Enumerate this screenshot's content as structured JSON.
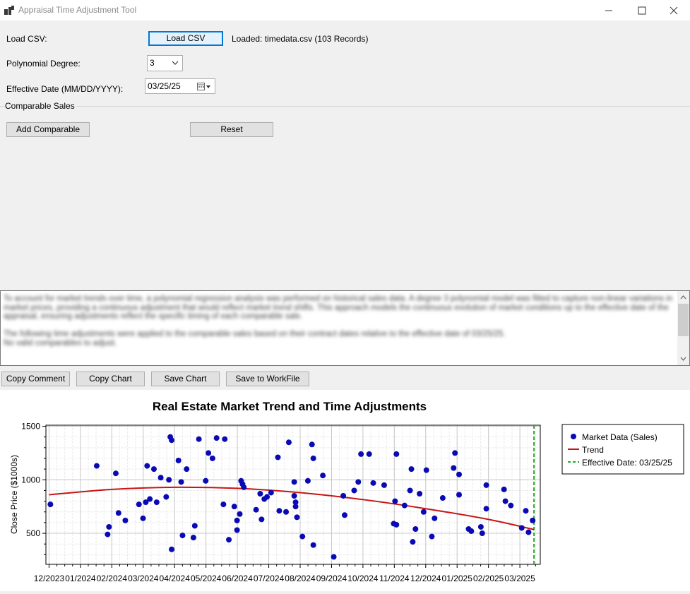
{
  "window": {
    "title": "Appraisal Time Adjustment Tool"
  },
  "form": {
    "load_csv_label": "Load CSV:",
    "load_csv_button": "Load CSV",
    "load_status": "Loaded: timedata.csv (103 Records)",
    "poly_degree_label": "Polynomial Degree:",
    "poly_degree_value": "3",
    "effective_date_label": "Effective Date (MM/DD/YYYY):",
    "effective_date_value": "03/25/25"
  },
  "comparables": {
    "group_title": "Comparable Sales",
    "add_button": "Add Comparable",
    "reset_button": "Reset"
  },
  "comment": {
    "paragraph1": "To account for market trends over time, a polynomial regression analysis was performed on historical sales data. A degree 3 polynomial model was fitted to capture non-linear variations in market prices, providing a continuous adjustment that would reflect market trend shifts. This approach models the continuous evolution of market conditions up to the effective date of the appraisal, ensuring adjustments reflect the specific timing of each comparable sale.",
    "paragraph2": "The following time adjustments were applied to the comparable sales based on their contract dates relative to the effective date of 03/25/25.",
    "paragraph3": "No valid comparables to adjust."
  },
  "actions": {
    "copy_comment": "Copy Comment",
    "copy_chart": "Copy Chart",
    "save_chart": "Save Chart",
    "save_workfile": "Save to WorkFile"
  },
  "colors": {
    "point": "#0a0ab4",
    "trend": "#c81414",
    "effective": "#22aa22",
    "accent": "#0078d7"
  },
  "chart_data": {
    "type": "scatter",
    "title": "Real Estate Market Trend and Time Adjustments",
    "xlabel": "",
    "ylabel": "Close Price ($1000s)",
    "x_tick_labels": [
      "12/2023",
      "01/2024",
      "02/2024",
      "03/2024",
      "04/2024",
      "05/2024",
      "06/2024",
      "07/2024",
      "08/2024",
      "09/2024",
      "10/2024",
      "11/2024",
      "12/2024",
      "01/2025",
      "02/2025",
      "03/2025"
    ],
    "y_ticks": [
      500,
      1000,
      1500
    ],
    "ylim": [
      210,
      1510
    ],
    "xlim_months": [
      -0.1,
      15.65
    ],
    "grid": true,
    "legend_position": "right",
    "legend": [
      "Market Data (Sales)",
      "Trend",
      "Effective Date: 03/25/25"
    ],
    "effective_date_month": 15.45,
    "trend": {
      "months": [
        0,
        2,
        4,
        6,
        8,
        10,
        12,
        14,
        15.45
      ],
      "values": [
        860,
        910,
        930,
        920,
        880,
        815,
        730,
        630,
        535
      ]
    },
    "points": [
      [
        0.05,
        770
      ],
      [
        1.75,
        1130
      ],
      [
        2.15,
        490
      ],
      [
        2.2,
        560
      ],
      [
        2.45,
        1060
      ],
      [
        2.55,
        690
      ],
      [
        2.8,
        620
      ],
      [
        3.3,
        770
      ],
      [
        3.45,
        640
      ],
      [
        3.6,
        1130
      ],
      [
        3.7,
        820
      ],
      [
        3.85,
        1100
      ],
      [
        3.95,
        790
      ],
      [
        4.1,
        1020
      ],
      [
        4.3,
        840
      ],
      [
        4.4,
        1000
      ],
      [
        4.45,
        1400
      ],
      [
        4.5,
        1370
      ],
      [
        4.5,
        350
      ],
      [
        4.75,
        1180
      ],
      [
        4.85,
        980
      ],
      [
        4.9,
        480
      ],
      [
        5.05,
        1100
      ],
      [
        5.3,
        460
      ],
      [
        5.35,
        570
      ],
      [
        5.5,
        1380
      ],
      [
        5.75,
        990
      ],
      [
        5.85,
        1250
      ],
      [
        6.0,
        1200
      ],
      [
        6.15,
        1390
      ],
      [
        6.4,
        770
      ],
      [
        6.6,
        440
      ],
      [
        6.8,
        750
      ],
      [
        6.9,
        620
      ],
      [
        6.9,
        530
      ],
      [
        7.0,
        680
      ],
      [
        7.05,
        990
      ],
      [
        7.1,
        960
      ],
      [
        7.15,
        930
      ],
      [
        7.6,
        720
      ],
      [
        7.75,
        870
      ],
      [
        7.8,
        630
      ],
      [
        7.9,
        820
      ],
      [
        8.0,
        840
      ],
      [
        8.15,
        880
      ],
      [
        8.4,
        1210
      ],
      [
        8.45,
        710
      ],
      [
        8.7,
        700
      ],
      [
        8.8,
        1350
      ],
      [
        9.0,
        980
      ],
      [
        9.0,
        850
      ],
      [
        9.05,
        790
      ],
      [
        9.05,
        750
      ],
      [
        9.1,
        650
      ],
      [
        9.3,
        470
      ],
      [
        9.5,
        990
      ],
      [
        9.65,
        1330
      ],
      [
        9.7,
        1200
      ],
      [
        9.7,
        390
      ],
      [
        10.05,
        1040
      ],
      [
        10.45,
        280
      ],
      [
        10.8,
        850
      ],
      [
        10.85,
        670
      ],
      [
        11.2,
        900
      ],
      [
        11.35,
        980
      ],
      [
        11.45,
        1240
      ],
      [
        11.75,
        1240
      ],
      [
        11.9,
        970
      ],
      [
        12.3,
        950
      ],
      [
        12.65,
        590
      ],
      [
        12.75,
        580
      ],
      [
        12.7,
        800
      ],
      [
        12.75,
        1240
      ],
      [
        13.05,
        760
      ],
      [
        13.25,
        900
      ],
      [
        13.3,
        1100
      ],
      [
        13.35,
        420
      ],
      [
        13.45,
        540
      ],
      [
        13.6,
        870
      ],
      [
        13.75,
        700
      ],
      [
        14.05,
        470
      ],
      [
        14.15,
        640
      ],
      [
        14.45,
        830
      ],
      [
        14.85,
        1110
      ],
      [
        14.9,
        1250
      ],
      [
        15.05,
        860
      ],
      [
        15.05,
        1050
      ],
      [
        15.4,
        540
      ],
      [
        15.5,
        520
      ],
      [
        15.85,
        560
      ],
      [
        15.9,
        500
      ],
      [
        16.05,
        950
      ],
      [
        16.05,
        730
      ],
      [
        16.7,
        910
      ],
      [
        16.75,
        800
      ],
      [
        16.95,
        760
      ],
      [
        17.35,
        550
      ],
      [
        17.5,
        710
      ],
      [
        17.6,
        510
      ],
      [
        17.75,
        620
      ],
      [
        3.55,
        790
      ],
      [
        6.45,
        1380
      ],
      [
        13.85,
        1090
      ]
    ]
  }
}
